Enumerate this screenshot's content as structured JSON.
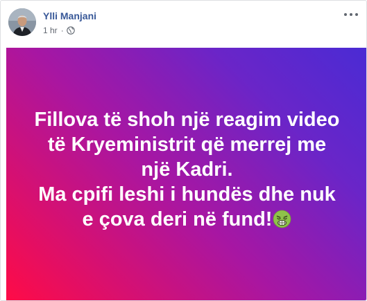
{
  "post": {
    "author": {
      "name": "Ylli Manjani"
    },
    "timestamp": "1 hr",
    "separator": "·",
    "privacy_icon": "globe-icon",
    "menu_icon": "more-options-icon",
    "text_lines": [
      "Fillova të shoh një reagim video",
      "të Kryeministrit që merrej me",
      "një Kadri.",
      "Ma cpifi leshi i hundës dhe nuk",
      "e çova deri në fund!"
    ],
    "emoji_icon": "nauseated-face-icon",
    "colors": {
      "author_link": "#385898",
      "meta_text": "#616770",
      "background_gradient_start": "#ff0b46",
      "background_gradient_mid": "#a816a2",
      "background_gradient_end": "#4a2bd4",
      "post_text": "#ffffff",
      "emoji_face": "#8fc14a"
    }
  }
}
